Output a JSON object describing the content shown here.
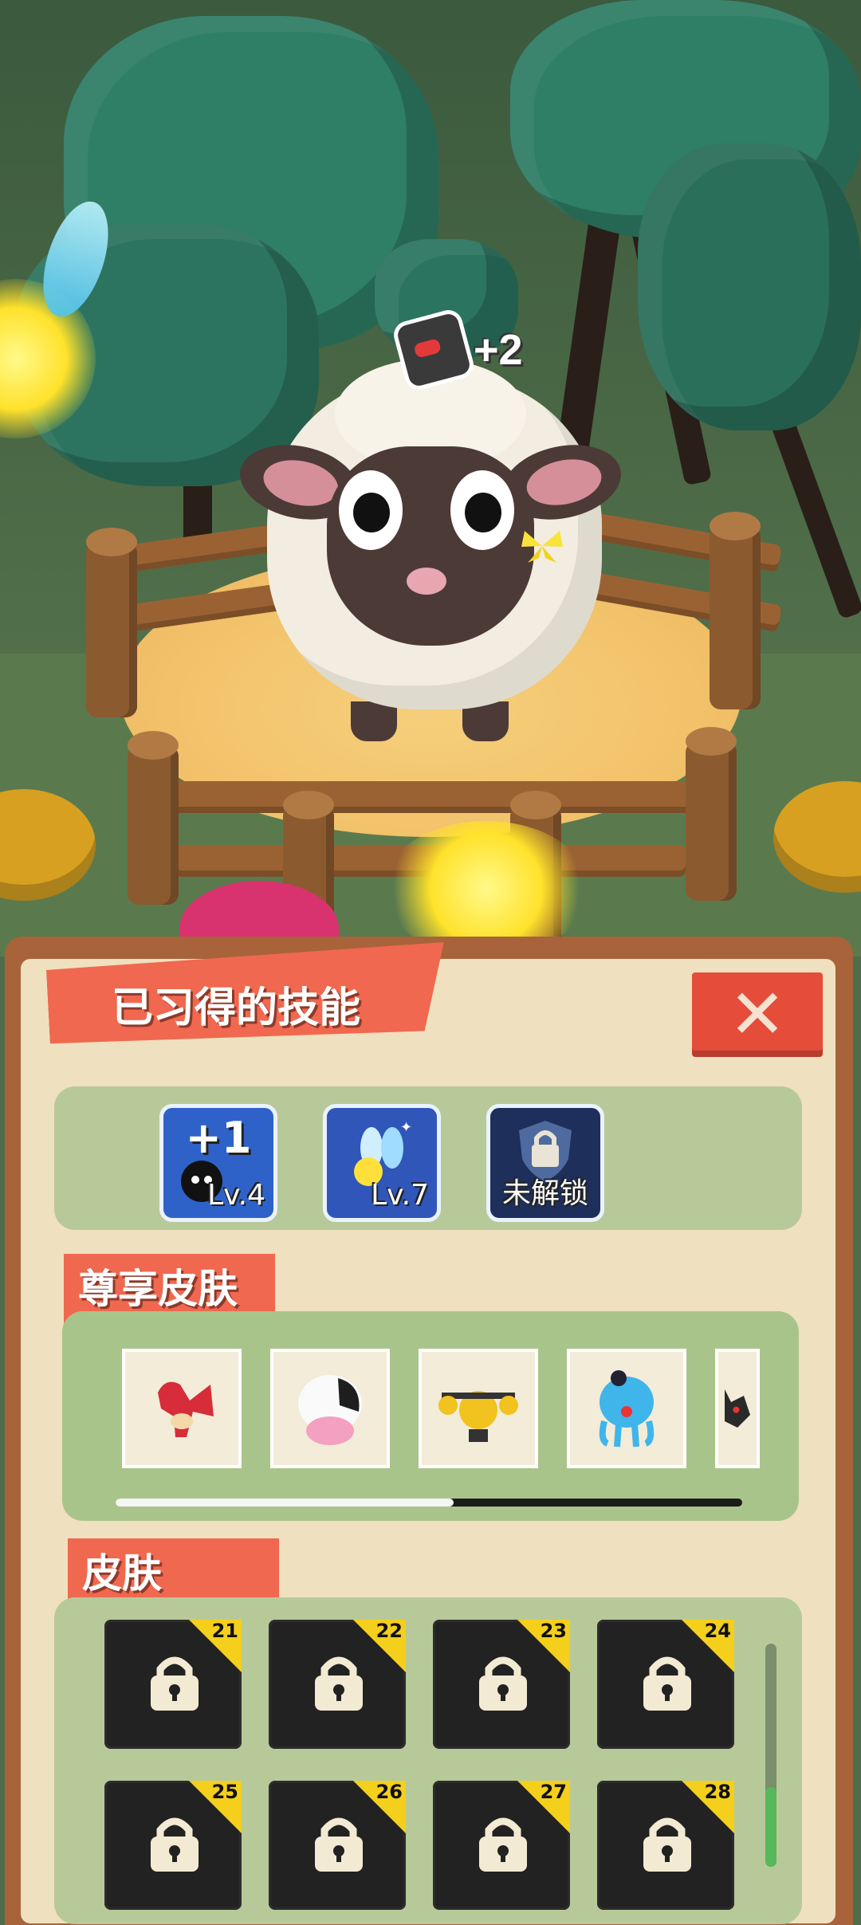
{
  "hud": {
    "bonus_value": "+2",
    "bonus_icon": "skull-bomb-icon"
  },
  "panel": {
    "title": "已习得的技能",
    "close_label": "✕",
    "skills": [
      {
        "top": "+1",
        "label": "Lv.4",
        "icon": "bomb-plus-one-icon",
        "bg": "#2f62c9"
      },
      {
        "top": "",
        "label": "Lv.7",
        "icon": "sparkle-wings-icon",
        "bg": "#2f56b8"
      },
      {
        "top": "",
        "label": "未解锁",
        "icon": "shield-lock-icon",
        "bg": "#1d2f5a"
      }
    ],
    "premium_section_label": "尊享皮肤",
    "premium_skins": [
      {
        "icon": "red-dragon-icon"
      },
      {
        "icon": "cow-icon"
      },
      {
        "icon": "yellow-drone-icon"
      },
      {
        "icon": "blue-jellyfish-icon"
      },
      {
        "icon": "black-cat-icon"
      }
    ],
    "premium_scroll_fraction": 0.54,
    "skins_section_label": "皮肤",
    "skins": [
      {
        "number": "21",
        "locked": true
      },
      {
        "number": "22",
        "locked": true
      },
      {
        "number": "23",
        "locked": true
      },
      {
        "number": "24",
        "locked": true
      },
      {
        "number": "25",
        "locked": true
      },
      {
        "number": "26",
        "locked": true
      },
      {
        "number": "27",
        "locked": true
      },
      {
        "number": "28",
        "locked": true
      }
    ]
  },
  "colors": {
    "accent": "#f0684f",
    "panel_bg": "#efe0bf",
    "frame": "#a8633a",
    "box": "#b8c999",
    "badge": "#f4cf1c"
  }
}
